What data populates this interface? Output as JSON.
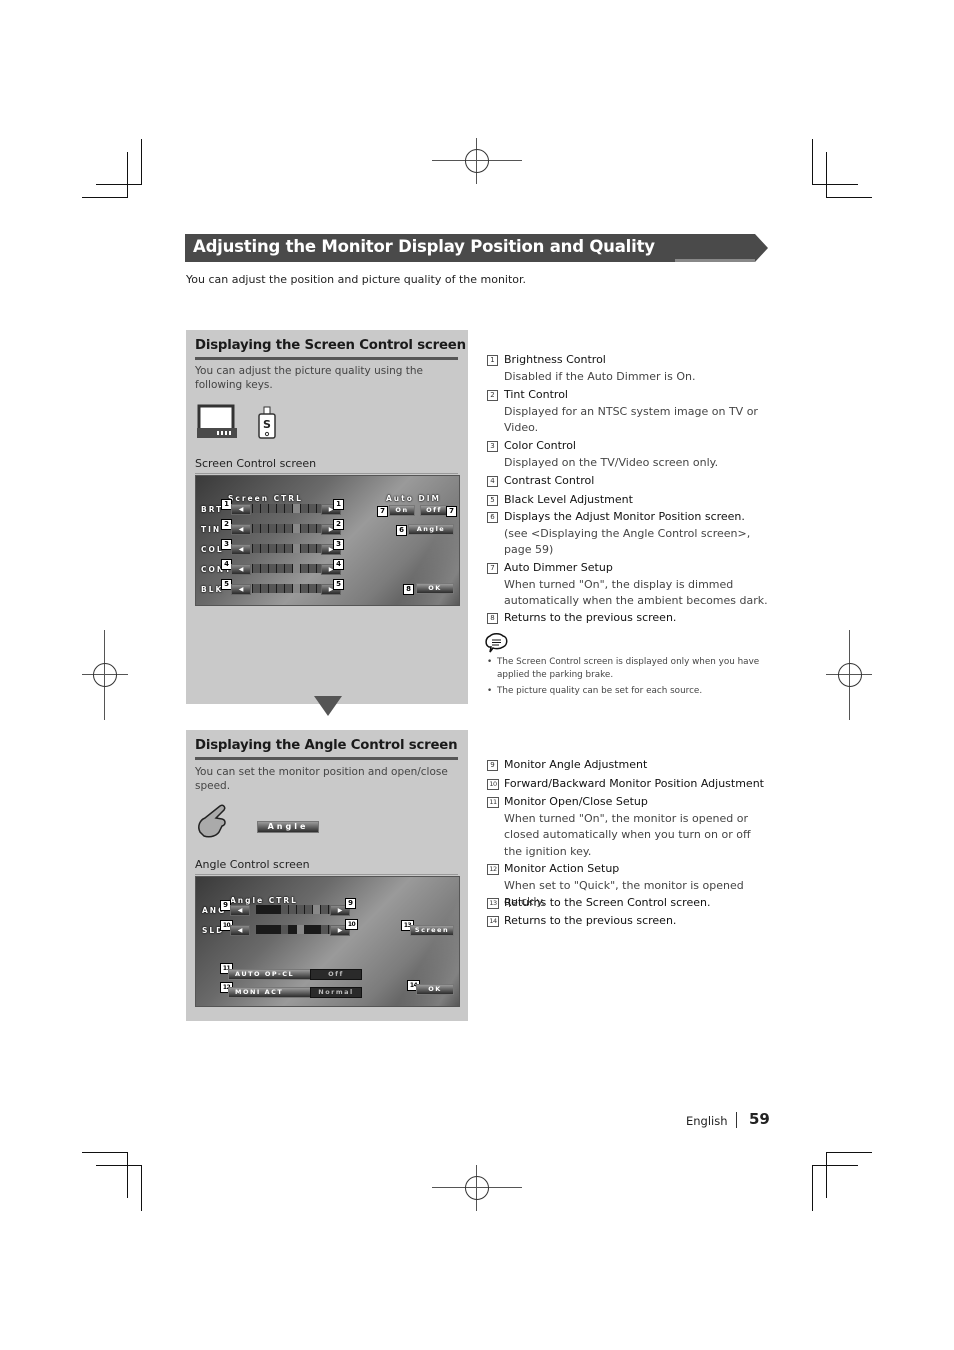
{
  "header": {
    "title": "Adjusting the Monitor Display Position and Quality",
    "intro": "You can adjust the position and picture quality of the monitor."
  },
  "screen_control_section": {
    "title": "Displaying the Screen Control screen",
    "description": "You can adjust the picture quality using the following keys.",
    "key_icons": [
      "monitor-key-icon",
      "remote-s-key-icon"
    ],
    "remote_key_letter": "S",
    "caption": "Screen Control screen",
    "screen": {
      "heading": "Screen CTRL",
      "rows": [
        {
          "label": "BRT",
          "callout": "1"
        },
        {
          "label": "TIN",
          "callout": "2"
        },
        {
          "label": "COL",
          "callout": "3"
        },
        {
          "label": "CONT",
          "callout": "4"
        },
        {
          "label": "BLK",
          "callout": "5"
        }
      ],
      "auto_dim_label": "Auto DIM",
      "on_label": "On",
      "off_label": "Off",
      "auto_dim_callout": "7",
      "angle_label": "Angle",
      "angle_callout": "6",
      "ok_label": "OK",
      "ok_callout": "8"
    }
  },
  "screen_control_items": [
    {
      "num": "1",
      "title": "Brightness Control",
      "desc": "Disabled if the Auto Dimmer is On."
    },
    {
      "num": "2",
      "title": "Tint Control",
      "desc": "Displayed for an NTSC system image on TV or Video."
    },
    {
      "num": "3",
      "title": "Color Control",
      "desc": "Displayed on the TV/Video screen only."
    },
    {
      "num": "4",
      "title": "Contrast Control",
      "desc": ""
    },
    {
      "num": "5",
      "title": "Black Level Adjustment",
      "desc": ""
    },
    {
      "num": "6",
      "title": "Displays the Adjust Monitor Position screen.",
      "desc": "(see <Displaying the Angle Control screen>, page 59)"
    },
    {
      "num": "7",
      "title": "Auto Dimmer Setup",
      "desc": "When turned \"On\", the display is dimmed automatically when the ambient becomes dark."
    },
    {
      "num": "8",
      "title": "Returns to the previous screen.",
      "desc": ""
    }
  ],
  "notes": [
    "The Screen Control screen is displayed only when you have applied the parking brake.",
    "The picture quality can be set for each source."
  ],
  "angle_control_section": {
    "title": "Displaying the Angle Control screen",
    "description": "You can set the monitor position and open/close speed.",
    "angle_key_label": "Angle",
    "caption": "Angle Control screen",
    "screen": {
      "heading": "Angle CTRL",
      "ang_label": "ANG",
      "ang_callout": "9",
      "sld_label": "SLD",
      "sld_callout": "10",
      "screen_label": "Screen",
      "screen_callout": "13",
      "auto_opcl_label": "AUTO OP-CL",
      "auto_opcl_value": "Off",
      "auto_opcl_callout": "11",
      "moni_act_label": "MONI ACT",
      "moni_act_value": "Normal",
      "moni_act_callout": "12",
      "ok_label": "OK",
      "ok_callout": "14"
    }
  },
  "angle_control_items": [
    {
      "num": "9",
      "title": "Monitor Angle Adjustment",
      "desc": ""
    },
    {
      "num": "10",
      "title": "Forward/Backward Monitor Position Adjustment",
      "desc": ""
    },
    {
      "num": "11",
      "title": "Monitor Open/Close Setup",
      "desc": "When turned \"On\", the monitor is opened or closed automatically when you turn on or off the ignition key."
    },
    {
      "num": "12",
      "title": "Monitor Action Setup",
      "desc": "When set to \"Quick\", the monitor is opened quickly."
    },
    {
      "num": "13",
      "title": "Returns to the Screen Control screen.",
      "desc": ""
    },
    {
      "num": "14",
      "title": "Returns to the previous screen.",
      "desc": ""
    }
  ],
  "footer": {
    "language": "English",
    "page_number": "59"
  },
  "colors": {
    "banner": "#4a4a4a",
    "panel": "#c9c9c9",
    "text": "#222222"
  }
}
